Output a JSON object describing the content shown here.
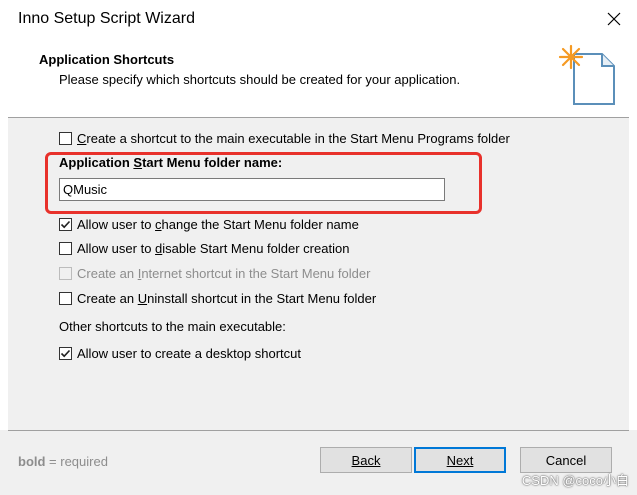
{
  "window": {
    "title": "Inno Setup Script Wizard"
  },
  "header": {
    "title": "Application Shortcuts",
    "subtitle": "Please specify which shortcuts should be created for your application.",
    "image_icon": "wizard-document-sparkle-icon"
  },
  "options": {
    "start_menu_shortcut": {
      "label": "Create a shortcut to the main executable in the Start Menu Programs folder",
      "checked": false,
      "enabled": true
    },
    "folder_name_label": "Application Start Menu folder name:",
    "folder_name_value": "QMusic",
    "change_folder": {
      "label": "Allow user to change the Start Menu folder name",
      "checked": true,
      "enabled": true
    },
    "disable_folder": {
      "label": "Allow user to disable Start Menu folder creation",
      "checked": false,
      "enabled": true
    },
    "internet_shortcut": {
      "label": "Create an Internet shortcut in the Start Menu folder",
      "checked": false,
      "enabled": false
    },
    "uninstall_shortcut": {
      "label": "Create an Uninstall shortcut in the Start Menu folder",
      "checked": false,
      "enabled": true
    },
    "other_label": "Other shortcuts to the main executable:",
    "desktop_shortcut": {
      "label": "Allow user to create a desktop shortcut",
      "checked": true,
      "enabled": true
    }
  },
  "footer": {
    "hint_bold": "bold",
    "hint_rest": " = required",
    "back_label": "Back",
    "next_label": "Next",
    "cancel_label": "Cancel"
  },
  "watermark": "CSDN @coco小白",
  "colors": {
    "highlight": "#e8312b",
    "default_button_border": "#0078d7",
    "sparkle": "#f59a23"
  }
}
